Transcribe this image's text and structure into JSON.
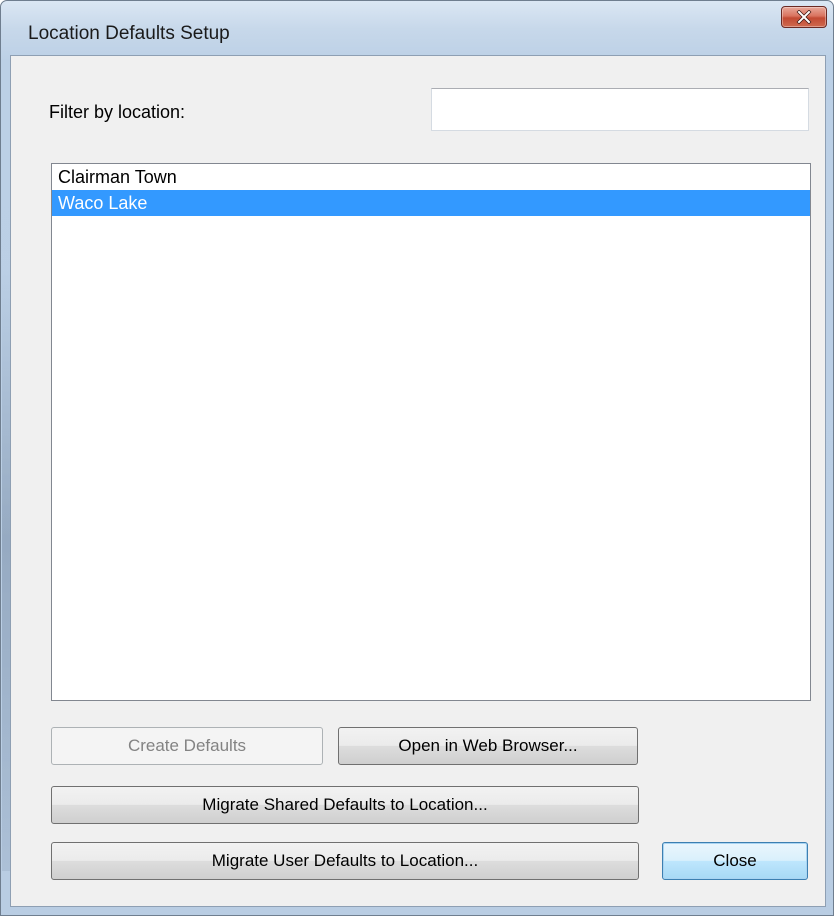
{
  "window": {
    "title": "Location Defaults Setup"
  },
  "filter": {
    "label": "Filter by location:",
    "value": "",
    "placeholder": ""
  },
  "locations": {
    "items": [
      {
        "label": "Clairman Town",
        "selected": false
      },
      {
        "label": "Waco Lake",
        "selected": true
      }
    ]
  },
  "buttons": {
    "create_defaults": "Create Defaults",
    "open_browser": "Open in Web Browser...",
    "migrate_shared": "Migrate Shared Defaults to Location...",
    "migrate_user": "Migrate User Defaults to Location...",
    "close": "Close"
  },
  "colors": {
    "selection": "#3399ff",
    "close_button": "#c24a34",
    "dialog_background": "#f0f0f0"
  },
  "icons": {
    "close": "close-x-icon"
  }
}
